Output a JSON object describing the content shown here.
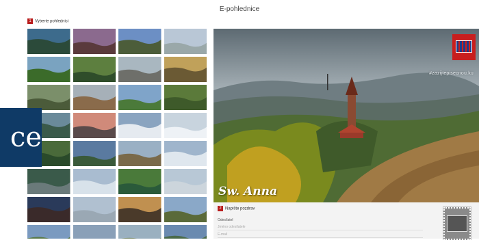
{
  "page": {
    "title": "E-pohlednice"
  },
  "steps": {
    "choose": {
      "number": "1",
      "label": "Vyberte pohlednici"
    },
    "write": {
      "number": "2",
      "label": "Napište pozdrav"
    }
  },
  "hero": {
    "name": "Sw. Anna",
    "hashtag": "#zazijtepisecnou.ku"
  },
  "form": {
    "sender_label": "Odesílatel",
    "name_placeholder": "Jméno odesílatele",
    "email_placeholder": "E-mail"
  },
  "overlay": {
    "text": "ce"
  },
  "thumbnails": [
    {
      "name": "thumb-lake-forest",
      "sky": "#3d6b8c",
      "ground": "#2b4a3a"
    },
    {
      "name": "thumb-sunset-hills",
      "sky": "#8b6a8e",
      "ground": "#5a3a3c"
    },
    {
      "name": "thumb-tower-dusk",
      "sky": "#6c8fc4",
      "ground": "#4c5d3a"
    },
    {
      "name": "thumb-snow-lookout",
      "sky": "#b9c7d6",
      "ground": "#9aa8a9"
    },
    {
      "name": "thumb-forest-valley",
      "sky": "#7aa3c0",
      "ground": "#3b6b2a"
    },
    {
      "name": "thumb-cottage",
      "sky": "#5d7f3f",
      "ground": "#2f4d2a"
    },
    {
      "name": "thumb-road",
      "sky": "#a9b7c0",
      "ground": "#6e6f6a"
    },
    {
      "name": "thumb-forest-path",
      "sky": "#c0a15a",
      "ground": "#6b5a34"
    },
    {
      "name": "thumb-rock-ruin",
      "sky": "#7b8f6a",
      "ground": "#4b5b3a"
    },
    {
      "name": "thumb-castle-ruin",
      "sky": "#a6b0b8",
      "ground": "#8a6b4b"
    },
    {
      "name": "thumb-green-hills",
      "sky": "#7fa4c9",
      "ground": "#4b7a3a"
    },
    {
      "name": "thumb-birch-forest",
      "sky": "#5b7a3a",
      "ground": "#3e5a2a"
    },
    {
      "name": "thumb-stone-tower",
      "sky": "#6a8a9a",
      "ground": "#3a5a4a"
    },
    {
      "name": "thumb-village-sunset",
      "sky": "#d08a7a",
      "ground": "#5a4a4a"
    },
    {
      "name": "thumb-snow-field",
      "sky": "#8aa4c0",
      "ground": "#e5eaf0"
    },
    {
      "name": "thumb-winter-lookout",
      "sky": "#c8d4de",
      "ground": "#eef2f6"
    },
    {
      "name": "thumb-forest-stream",
      "sky": "#4a6a3a",
      "ground": "#2a4a2a"
    },
    {
      "name": "thumb-hill-monument",
      "sky": "#5a7aa0",
      "ground": "#3a5a3a"
    },
    {
      "name": "thumb-old-tower",
      "sky": "#9ab0c4",
      "ground": "#7a6a4a"
    },
    {
      "name": "thumb-winter-tower",
      "sky": "#9fb5cc",
      "ground": "#dfe7ee"
    },
    {
      "name": "thumb-waterfall",
      "sky": "#3a5a4a",
      "ground": "#6a7a7a"
    },
    {
      "name": "thumb-snow-valley",
      "sky": "#a9bcd0",
      "ground": "#d8e2ea"
    },
    {
      "name": "thumb-forest-lake",
      "sky": "#4a7a3a",
      "ground": "#2a5a3a"
    },
    {
      "name": "thumb-castle-snow",
      "sky": "#b8c8d6",
      "ground": "#ccd5dc"
    },
    {
      "name": "thumb-night-sky",
      "sky": "#2a3a5a",
      "ground": "#3a2a2a"
    },
    {
      "name": "thumb-frost-lookout",
      "sky": "#b0c0d0",
      "ground": "#9aa8b4"
    },
    {
      "name": "thumb-tower-sunset",
      "sky": "#c09050",
      "ground": "#4a3a2a"
    },
    {
      "name": "thumb-wide-valley",
      "sky": "#8aa8c8",
      "ground": "#5a6a3a"
    },
    {
      "name": "thumb-bottom-1",
      "sky": "#7a9ac0",
      "ground": "#5a7a4a"
    },
    {
      "name": "thumb-bottom-2",
      "sky": "#8aa0b8",
      "ground": "#6a6a5a"
    },
    {
      "name": "thumb-bottom-3",
      "sky": "#9ab0c0",
      "ground": "#7a8a6a"
    },
    {
      "name": "thumb-bottom-4",
      "sky": "#6a8ab0",
      "ground": "#4a6a4a"
    }
  ]
}
